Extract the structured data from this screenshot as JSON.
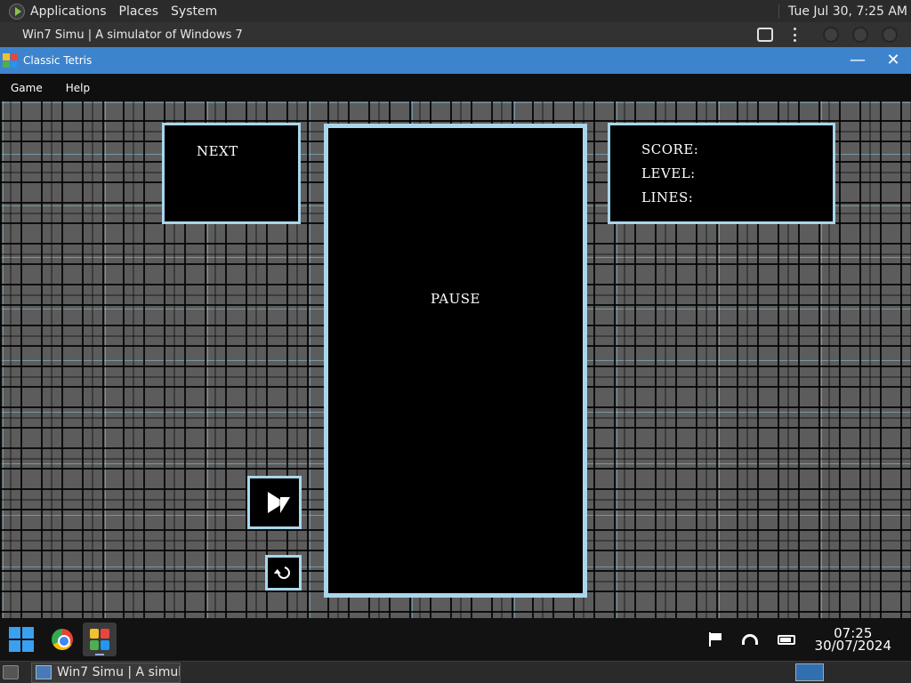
{
  "topbar": {
    "menus": [
      "Applications",
      "Places",
      "System"
    ],
    "clock": "Tue Jul 30,  7:25 AM"
  },
  "app": {
    "title": "Win7 Simu | A simulator of Windows 7"
  },
  "window": {
    "title": "Classic Tetris",
    "minimize": "—",
    "close": "✕",
    "menus": [
      "Game",
      "Help"
    ]
  },
  "game": {
    "next_label": "NEXT",
    "pause_label": "PAUSE",
    "score_label": "SCORE:",
    "level_label": "LEVEL:",
    "lines_label": "LINES:",
    "border_color": "#a9d6ec"
  },
  "taskbar": {
    "time": "07:25",
    "date": "30/07/2024"
  },
  "hostbar": {
    "task_label": "Win7 Simu | A simula..."
  },
  "icons": {
    "start": "windows-start-icon",
    "play": "play-icon",
    "restart": "restart-icon"
  }
}
